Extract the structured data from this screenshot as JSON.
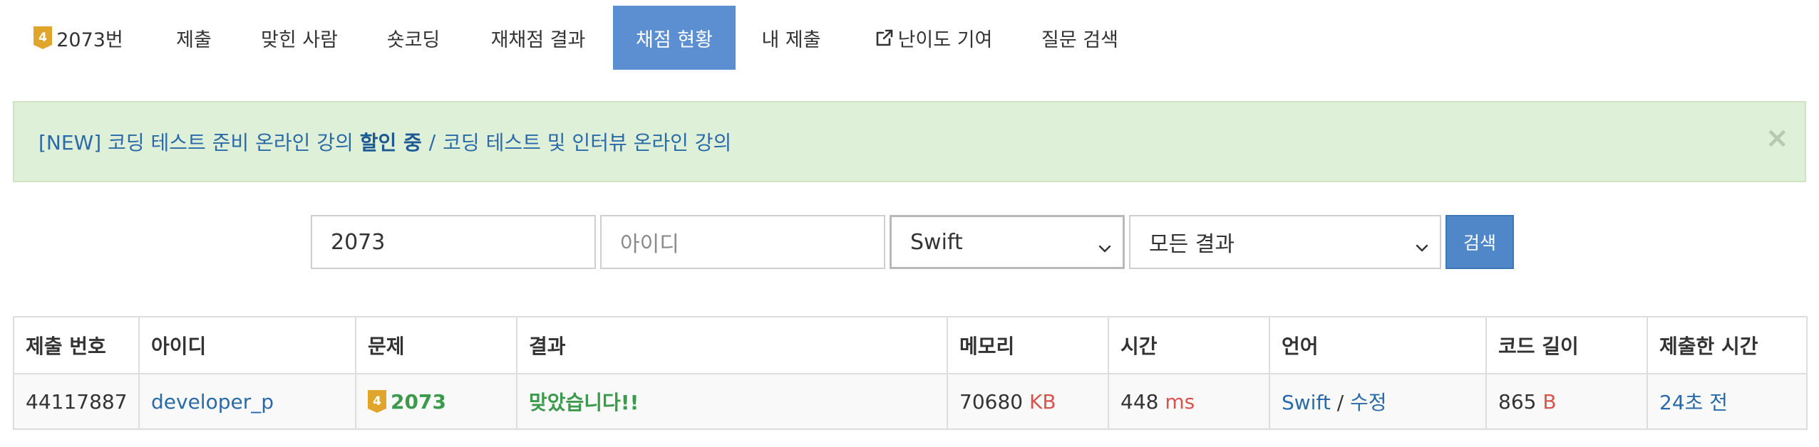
{
  "tabs": {
    "problem": {
      "tier_level": "4",
      "label": "2073번"
    },
    "submit": "제출",
    "solvers": "맞힌 사람",
    "shortcoding": "숏코딩",
    "rejudge": "재채점 결과",
    "status": "채점 현황",
    "my_submissions": "내 제출",
    "difficulty": "난이도 기여",
    "questions": "질문 검색"
  },
  "alert": {
    "prefix": "[NEW] 코딩 테스트 준비 온라인 강의",
    "highlight": "할인 중",
    "separator": "/",
    "second_link": "코딩 테스트 및 인터뷰 온라인 강의",
    "close": "×"
  },
  "search": {
    "problem_value": "2073",
    "user_placeholder": "아이디",
    "language_selected": "Swift",
    "result_selected": "모든 결과",
    "button": "검색"
  },
  "table": {
    "headers": {
      "id": "제출 번호",
      "user": "아이디",
      "problem": "문제",
      "result": "결과",
      "memory": "메모리",
      "time": "시간",
      "language": "언어",
      "length": "코드 길이",
      "submitted": "제출한 시간"
    },
    "rows": [
      {
        "id": "44117887",
        "user": "developer_p",
        "tier_level": "4",
        "problem": "2073",
        "result": "맞았습니다!!",
        "memory": "70680",
        "memory_unit": "KB",
        "time": "448",
        "time_unit": "ms",
        "language": "Swift",
        "lang_sep": "/",
        "edit": "수정",
        "length": "865",
        "length_unit": "B",
        "submitted": "24초 전"
      }
    ]
  },
  "colors": {
    "active_tab": "#5b8fd1",
    "tier_gold": "#e0a62c",
    "alert_bg": "#dff0d8",
    "link": "#2a6aa8",
    "accepted": "#3c9a4c",
    "unit": "#d9534f",
    "search_button": "#4f87c9"
  },
  "icons": {
    "tier": "gold-tier-badge-icon",
    "external": "external-link-icon",
    "close": "close-icon",
    "dropdown": "chevron-down-icon"
  }
}
